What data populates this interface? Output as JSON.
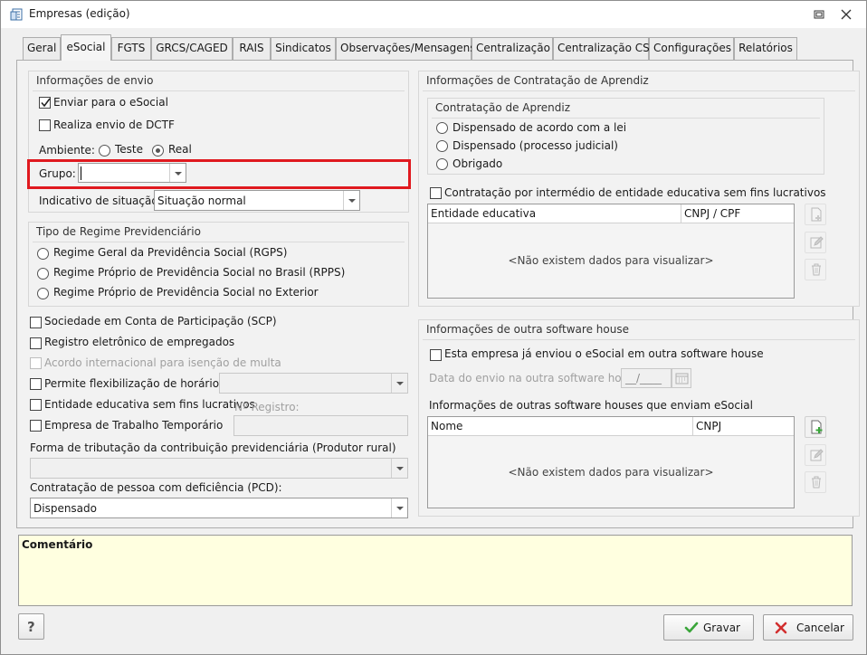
{
  "window": {
    "title": "Empresas (edição)"
  },
  "tabs": [
    {
      "label": "Geral",
      "active": false
    },
    {
      "label": "eSocial",
      "active": true
    },
    {
      "label": "FGTS",
      "active": false
    },
    {
      "label": "GRCS/CAGED",
      "active": false
    },
    {
      "label": "RAIS",
      "active": false
    },
    {
      "label": "Sindicatos",
      "active": false
    },
    {
      "label": "Observações/Mensagens",
      "active": false
    },
    {
      "label": "Centralização",
      "active": false
    },
    {
      "label": "Centralização CS",
      "active": false
    },
    {
      "label": "Configurações",
      "active": false
    },
    {
      "label": "Relatórios",
      "active": false
    }
  ],
  "envio": {
    "title": "Informações de envio",
    "enviar_esocial": {
      "label": "Enviar para o eSocial",
      "checked": true
    },
    "realiza_dctf": {
      "label": "Realiza envio de DCTF",
      "checked": false
    },
    "ambiente_label": "Ambiente:",
    "ambiente_teste": {
      "label": "Teste",
      "checked": false
    },
    "ambiente_real": {
      "label": "Real",
      "checked": true
    },
    "grupo_label": "Grupo:",
    "grupo_value": "",
    "indicativo_label": "Indicativo de situação:",
    "indicativo_value": "Situação normal"
  },
  "regime": {
    "title": "Tipo de Regime Previdenciário",
    "options": [
      {
        "label": "Regime Geral da Previdência Social (RGPS)",
        "checked": false
      },
      {
        "label": "Regime Próprio de Previdência Social no Brasil (RPPS)",
        "checked": false
      },
      {
        "label": "Regime Próprio de Previdência Social no Exterior",
        "checked": false
      }
    ]
  },
  "flags": {
    "scp": "Sociedade em Conta de Participação (SCP)",
    "registro_eletronico": "Registro eletrônico de empregados",
    "acordo_internacional": "Acordo internacional para isenção de multa",
    "flexibilizacao": "Permite flexibilização de horários",
    "entidade_educativa": "Entidade educativa sem fins lucrativos",
    "registro_label": "Nº Registro:",
    "trabalho_temporario": "Empresa de Trabalho Temporário"
  },
  "tributacao": {
    "label": "Forma de tributação da contribuição previdenciária (Produtor rural)",
    "value": ""
  },
  "pcd": {
    "label": "Contratação de pessoa com deficiência (PCD):",
    "value": "Dispensado"
  },
  "aprendiz": {
    "title": "Informações de Contratação de Aprendiz",
    "subtitle": "Contratação de Aprendiz",
    "options": [
      {
        "label": "Dispensado de acordo com a lei",
        "checked": false
      },
      {
        "label": "Dispensado (processo judicial)",
        "checked": false
      },
      {
        "label": "Obrigado",
        "checked": false
      }
    ],
    "intermedio_label": "Contratação por intermédio de entidade educativa sem fins lucrativos",
    "grid_columns": [
      "Entidade educativa",
      "CNPJ / CPF"
    ],
    "grid_empty": "<Não existem dados para visualizar>"
  },
  "software_house": {
    "title": "Informações de outra software house",
    "enviou_label": "Esta empresa já enviou o eSocial em outra software house",
    "data_label": "Data do envio na outra software house:",
    "data_value": "__/____",
    "outras_label": "Informações de outras software houses que enviam eSocial",
    "grid_columns": [
      "Nome",
      "CNPJ"
    ],
    "grid_empty": "<Não existem dados para visualizar>"
  },
  "comment": {
    "label": "Comentário"
  },
  "buttons": {
    "help": "?",
    "save": "Gravar",
    "cancel": "Cancelar"
  }
}
